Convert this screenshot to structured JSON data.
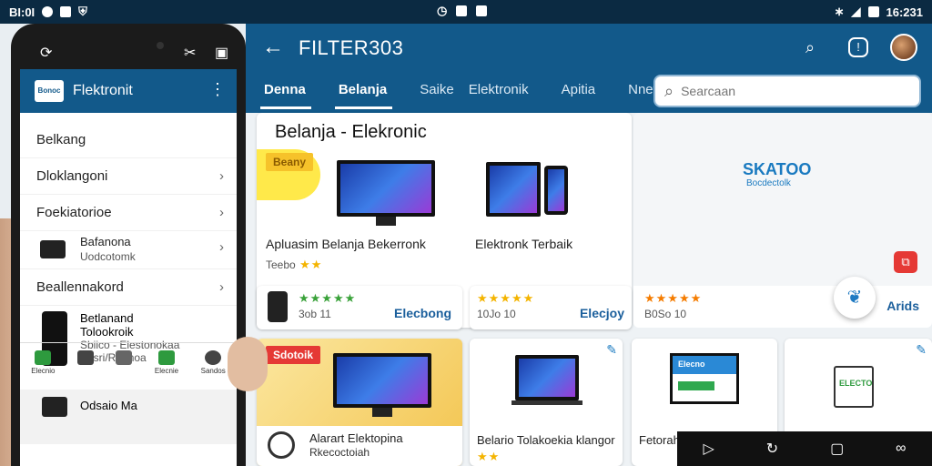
{
  "status_bar": {
    "left_text": "BI:0I",
    "time": "16:231"
  },
  "app": {
    "title": "FILTER303",
    "tabs": [
      "Denna",
      "Belanja",
      "Saike",
      "Elektronik",
      "Apitia",
      "Nnev"
    ],
    "search_placeholder": "Searcaan",
    "section_title": "Belanja - Elekronic"
  },
  "cards": {
    "c1": {
      "badge": "Beany",
      "name": "Apluasim Belanja Bekerronk",
      "meta": "Teebo",
      "link": "Elecbong",
      "price": "3ob 11"
    },
    "c2": {
      "name": "Elektronk Terbaik",
      "price": "10Jo 10",
      "link": "Elecjoy"
    },
    "c3": {
      "logo": "SKATOO",
      "logo_sub": "Bocdectolk",
      "price": "B0So 10",
      "link": "Arids"
    },
    "c4": {
      "badge": "Sdotoik",
      "name": "Alarart Elektopina",
      "sub": "Rkecoctoiah"
    },
    "c5": {
      "name": "Belario Tolakoekia klangor"
    },
    "c6": {
      "name": "Fetorah",
      "logo": "Elecno"
    },
    "c7": {
      "logo": "ELECTO"
    }
  },
  "phone": {
    "title": "Flektronit",
    "logo": "Bonoc",
    "items": [
      "Belkang",
      "Dloklangoni",
      "Foekiatorioe",
      "Bafanona",
      "Beallennakord"
    ],
    "item_sub": "Uodcotomk",
    "product": {
      "title": "Betlanand",
      "line2": "Tolookroik",
      "line3": "Sbiico - Elestonokaa",
      "line4": "Basri/Rannoa"
    },
    "bottom_nav": [
      "Elecnio",
      "",
      "",
      "Elecnie",
      "Sandos"
    ],
    "last_item": "Odsaio Ma"
  },
  "colors": {
    "appbar": "#12598a",
    "status_bar": "#0b2a42",
    "accent_red": "#e53935",
    "star": "#f4b400"
  }
}
